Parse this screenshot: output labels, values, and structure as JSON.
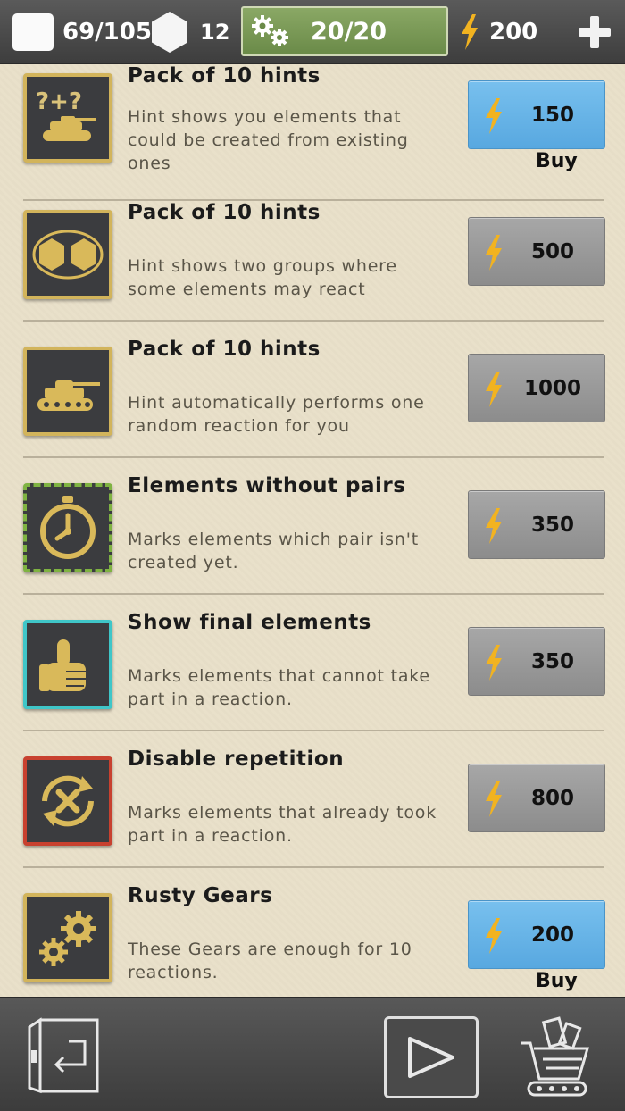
{
  "header": {
    "elements_count": "69/105",
    "hex_count": "12",
    "gears": "20/20",
    "energy": "200"
  },
  "items": [
    {
      "title": "Pack of 10 hints",
      "desc": "Hint shows you elements that could be created from existing ones",
      "price": "150",
      "buy": "Buy",
      "active": true,
      "icon": "question-tank-icon",
      "frame": "gold"
    },
    {
      "title": "Pack of 10 hints",
      "desc": "Hint shows two groups where some elements may react",
      "price": "500",
      "buy": "",
      "active": false,
      "icon": "two-hexagons-icon",
      "frame": "gold"
    },
    {
      "title": "Pack of 10 hints",
      "desc": "Hint automatically performs one random reaction for you",
      "price": "1000",
      "buy": "",
      "active": false,
      "icon": "tank-icon",
      "frame": "gold"
    },
    {
      "title": "Elements without pairs",
      "desc": "Marks elements which pair isn't created yet.",
      "price": "350",
      "buy": "",
      "active": false,
      "icon": "stopwatch-icon",
      "frame": "green"
    },
    {
      "title": "Show final elements",
      "desc": "Marks elements that cannot take part in a reaction.",
      "price": "350",
      "buy": "",
      "active": false,
      "icon": "thumbs-up-icon",
      "frame": "teal"
    },
    {
      "title": "Disable repetition",
      "desc": "Marks elements that already took part in a reaction.",
      "price": "800",
      "buy": "",
      "active": false,
      "icon": "no-repeat-icon",
      "frame": "red"
    },
    {
      "title": "Rusty Gears",
      "desc": "These Gears are enough for 10 reactions.",
      "price": "200",
      "buy": "Buy",
      "active": true,
      "icon": "gears-icon",
      "frame": "gold"
    }
  ],
  "colors": {
    "active_button": "#58a8e0",
    "inactive_button": "#9a9a9a",
    "gears_bar": "#7a9a55",
    "bolt": "#f2b320"
  },
  "footer": {
    "left_icon": "exit-door-icon",
    "center_icon": "play-icon",
    "right_icon": "shop-cart-icon"
  }
}
